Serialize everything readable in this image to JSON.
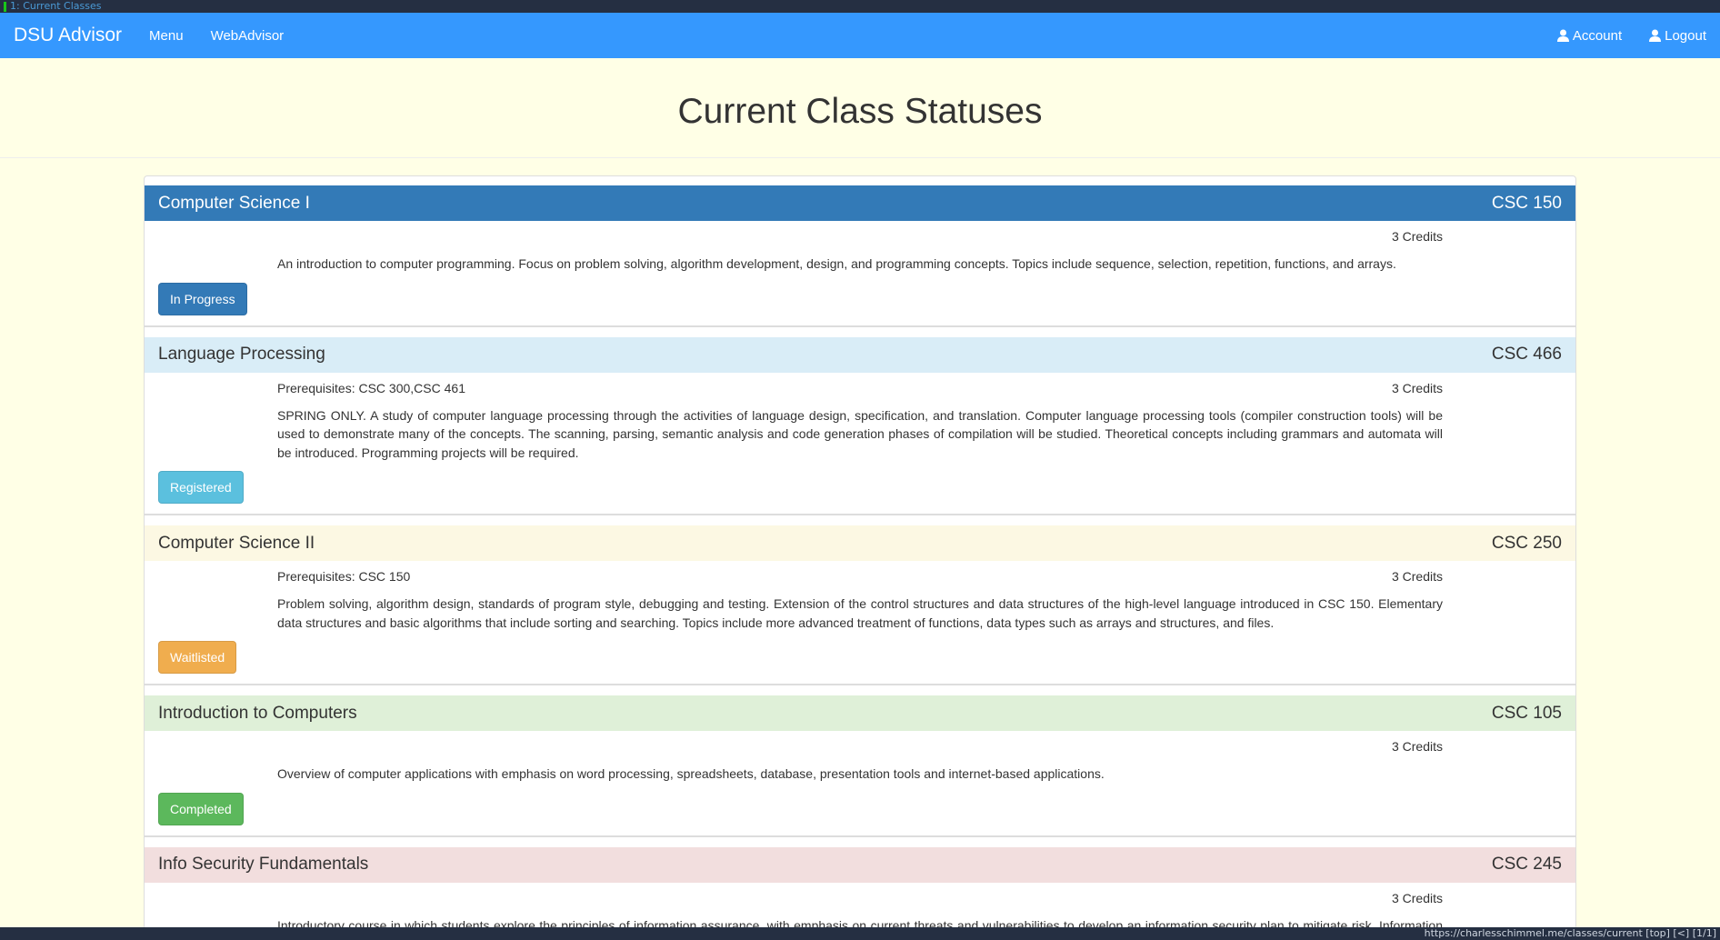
{
  "tab": {
    "title": "1: Current Classes"
  },
  "nav": {
    "brand": "DSU Advisor",
    "menu": "Menu",
    "webadvisor": "WebAdvisor",
    "account": "Account",
    "logout": "Logout"
  },
  "page": {
    "title": "Current Class Statuses"
  },
  "classes": [
    {
      "name": "Computer Science I",
      "code": "CSC 150",
      "prereq": "",
      "credits": "3 Credits",
      "description": "An introduction to computer programming. Focus on problem solving, algorithm development, design, and programming concepts. Topics include sequence, selection, repetition, functions, and arrays.",
      "status": "In Progress",
      "header_bg": "#337ab7",
      "header_fg": "#ffffff",
      "btn_bg": "#337ab7"
    },
    {
      "name": "Language Processing",
      "code": "CSC 466",
      "prereq": "Prerequisites: CSC 300,CSC 461",
      "credits": "3 Credits",
      "description": "SPRING ONLY. A study of computer language processing through the activities of language design, specification, and translation. Computer language processing tools (compiler construction tools) will be used to demonstrate many of the concepts. The scanning, parsing, semantic analysis and code generation phases of compilation will be studied. Theoretical concepts including grammars and automata will be introduced. Programming projects will be required.",
      "status": "Registered",
      "header_bg": "#d9edf7",
      "header_fg": "#333333",
      "btn_bg": "#5bc0de"
    },
    {
      "name": "Computer Science II",
      "code": "CSC 250",
      "prereq": "Prerequisites: CSC 150",
      "credits": "3 Credits",
      "description": "Problem solving, algorithm design, standards of program style, debugging and testing. Extension of the control structures and data structures of the high-level language introduced in CSC 150. Elementary data structures and basic algorithms that include sorting and searching. Topics include more advanced treatment of functions, data types such as arrays and structures, and files.",
      "status": "Waitlisted",
      "header_bg": "#fcf8e3",
      "header_fg": "#333333",
      "btn_bg": "#f0ad4e"
    },
    {
      "name": "Introduction to Computers",
      "code": "CSC 105",
      "prereq": "",
      "credits": "3 Credits",
      "description": "Overview of computer applications with emphasis on word processing, spreadsheets, database, presentation tools and internet-based applications.",
      "status": "Completed",
      "header_bg": "#dff0d8",
      "header_fg": "#333333",
      "btn_bg": "#5cb85c"
    },
    {
      "name": "Info Security Fundamentals",
      "code": "CSC 245",
      "prereq": "",
      "credits": "3 Credits",
      "description": "Introductory course in which students explore the principles of information assurance, with emphasis on current threats and vulnerabilities to develop an information security plan to mitigate risk. Information security and assurance issues are explored and a multidisciplinary approach is discussed that examines security policies, models, and mechanisms for confidentiality, integrity, and availability. Theory/Lab.",
      "status": "",
      "header_bg": "#f2dede",
      "header_fg": "#333333",
      "btn_bg": ""
    }
  ],
  "statusbar": {
    "text": "https://charlesschimmel.me/classes/current  [top] [<] [1/1]"
  }
}
